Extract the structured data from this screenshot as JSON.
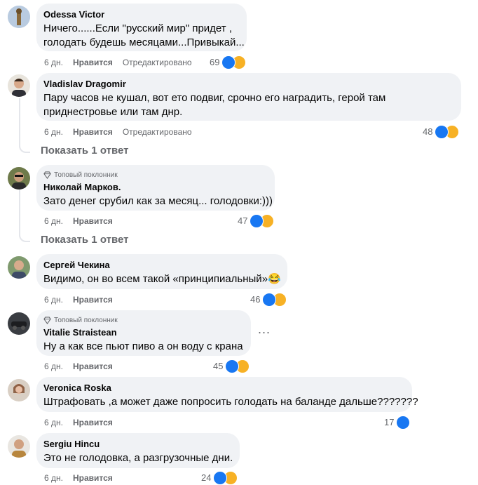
{
  "comments": [
    {
      "author": "Odessa Victor",
      "badge": "",
      "text": "Ничего......Если \"русский мир\" придет ,\nголодать будешь месяцами...Привыкай...",
      "time": "6 дн.",
      "like": "Нравится",
      "extra": "Отредактировано",
      "count": "69",
      "reactions": [
        "like",
        "haha"
      ]
    },
    {
      "author": "Vladislav Dragomir",
      "badge": "",
      "text": "Пару часов не кушал, вот ето подвиг, срочно его наградить, герой там\nприднестровье или там днр.",
      "time": "6 дн.",
      "like": "Нравится",
      "extra": "Отредактировано",
      "count": "48",
      "reactions": [
        "like",
        "haha"
      ],
      "replies": "Показать 1 ответ"
    },
    {
      "author": "Николай Марков.",
      "badge": "Топовый поклонник",
      "text": "Зато денег срубил как за месяц... голодовки:)))",
      "time": "6 дн.",
      "like": "Нравится",
      "extra": "",
      "count": "47",
      "reactions": [
        "like",
        "haha"
      ],
      "replies": "Показать 1 ответ"
    },
    {
      "author": "Сергей Чекина",
      "badge": "",
      "text": "Видимо, он во всем такой «принципиальный»😂",
      "time": "6 дн.",
      "like": "Нравится",
      "extra": "",
      "count": "46",
      "reactions": [
        "like",
        "haha"
      ]
    },
    {
      "author": "Vitalie Straistean",
      "badge": "Топовый поклонник",
      "text": "Ну а как все пьют пиво а он воду с крана",
      "time": "6 дн.",
      "like": "Нравится",
      "extra": "",
      "count": "45",
      "reactions": [
        "like",
        "haha"
      ]
    },
    {
      "author": "Veronica Roska",
      "badge": "",
      "text": "Штрафовать ,а может даже попросить голодать на баланде дальше???????",
      "time": "6 дн.",
      "like": "Нравится",
      "extra": "",
      "count": "17",
      "reactions": [
        "like"
      ]
    },
    {
      "author": "Sergiu Hincu",
      "badge": "",
      "text": "Это не голодовка, а разгрузочные дни.",
      "time": "6 дн.",
      "like": "Нравится",
      "extra": "",
      "count": "24",
      "reactions": [
        "like",
        "haha"
      ]
    }
  ],
  "more_menu": "...",
  "colors": {
    "like": "#1877f2",
    "haha": "#f7b125",
    "bubble": "#f0f2f5",
    "muted": "#65676b"
  }
}
